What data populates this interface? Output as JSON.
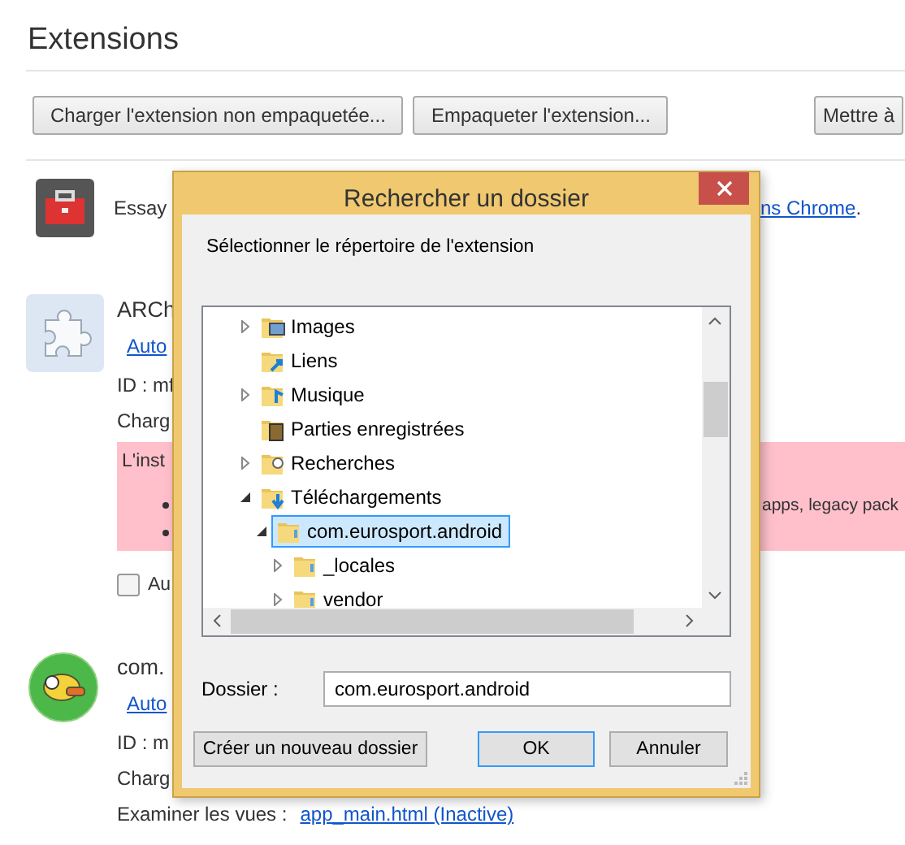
{
  "page": {
    "title": "Extensions"
  },
  "toolbar": [
    "Charger l'extension non empaquetée...",
    "Empaqueter l'extension...",
    "Mettre à"
  ],
  "promo": {
    "text": "Essay",
    "link": "ns Chrome",
    "end": "."
  },
  "extensions": [
    {
      "kind": "puzzle",
      "name": "ARCh",
      "link": "Auto",
      "id": "ID : mf",
      "loaded": "Charg",
      "warning": {
        "title": "L'inst",
        "bullets": [
          {
            "kind": "shown",
            "text": "apps, legacy pack"
          },
          {
            "kind": "covered"
          }
        ]
      },
      "option": {
        "label": "Au",
        "checked": false
      }
    },
    {
      "kind": "bird",
      "name": "com.",
      "link": "Auto",
      "id": "ID : m",
      "loaded": "Charg",
      "inspect": {
        "label": "Examiner les vues :",
        "link": "app_main.html (Inactive)"
      }
    }
  ],
  "dialog": {
    "title": "Rechercher un dossier",
    "prompt": "Sélectionner le répertoire de l'extension",
    "tree": [
      {
        "label": "Images",
        "kind": "pictures",
        "has_children": true,
        "expanded": false,
        "selected": false
      },
      {
        "label": "Liens",
        "kind": "links",
        "has_children": false,
        "selected": false
      },
      {
        "label": "Musique",
        "kind": "music",
        "has_children": true,
        "expanded": false,
        "selected": false
      },
      {
        "label": "Parties enregistrées",
        "kind": "games",
        "has_children": false,
        "selected": false
      },
      {
        "label": "Recherches",
        "kind": "searches",
        "has_children": true,
        "expanded": false,
        "selected": false
      },
      {
        "label": "Téléchargements",
        "kind": "downloads",
        "has_children": true,
        "expanded": true,
        "selected": false,
        "children": [
          {
            "label": "com.eurosport.android",
            "kind": "plain",
            "has_children": true,
            "expanded": true,
            "selected": true,
            "children": [
              {
                "label": "_locales",
                "kind": "plain",
                "has_children": true,
                "expanded": false,
                "selected": false
              },
              {
                "label": "vendor",
                "kind": "plain",
                "has_children": true,
                "expanded": false,
                "selected": false
              }
            ]
          }
        ]
      }
    ],
    "folder_label": "Dossier :",
    "folder_value": "com.eurosport.android",
    "buttons": [
      {
        "label": "Créer un nouveau dossier",
        "default": false
      },
      {
        "label": "OK",
        "default": true
      },
      {
        "label": "Annuler",
        "default": false
      }
    ]
  }
}
